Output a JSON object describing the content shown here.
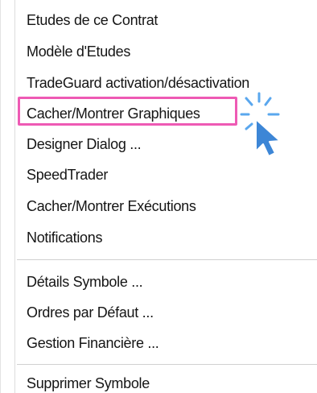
{
  "menu": {
    "items": [
      {
        "label": "Etudes de ce Contrat"
      },
      {
        "label": "Modèle d'Etudes"
      },
      {
        "label": "TradeGuard activation/désactivation"
      },
      {
        "label": "Cacher/Montrer Graphiques"
      },
      {
        "label": "Designer Dialog ..."
      },
      {
        "label": "SpeedTrader"
      },
      {
        "label": "Cacher/Montrer Exécutions"
      },
      {
        "label": "Notifications"
      },
      {
        "label": "Détails Symbole ..."
      },
      {
        "label": "Ordres par Défaut ..."
      },
      {
        "label": "Gestion Financière ..."
      },
      {
        "label": "Supprimer Symbole"
      }
    ]
  },
  "icons": {
    "cursor": "pointer-arrow-click-icon"
  },
  "colors": {
    "highlight": "#ee5ab4",
    "cursor_fill": "#3d86d6",
    "cursor_spark": "#5aa7ee"
  }
}
